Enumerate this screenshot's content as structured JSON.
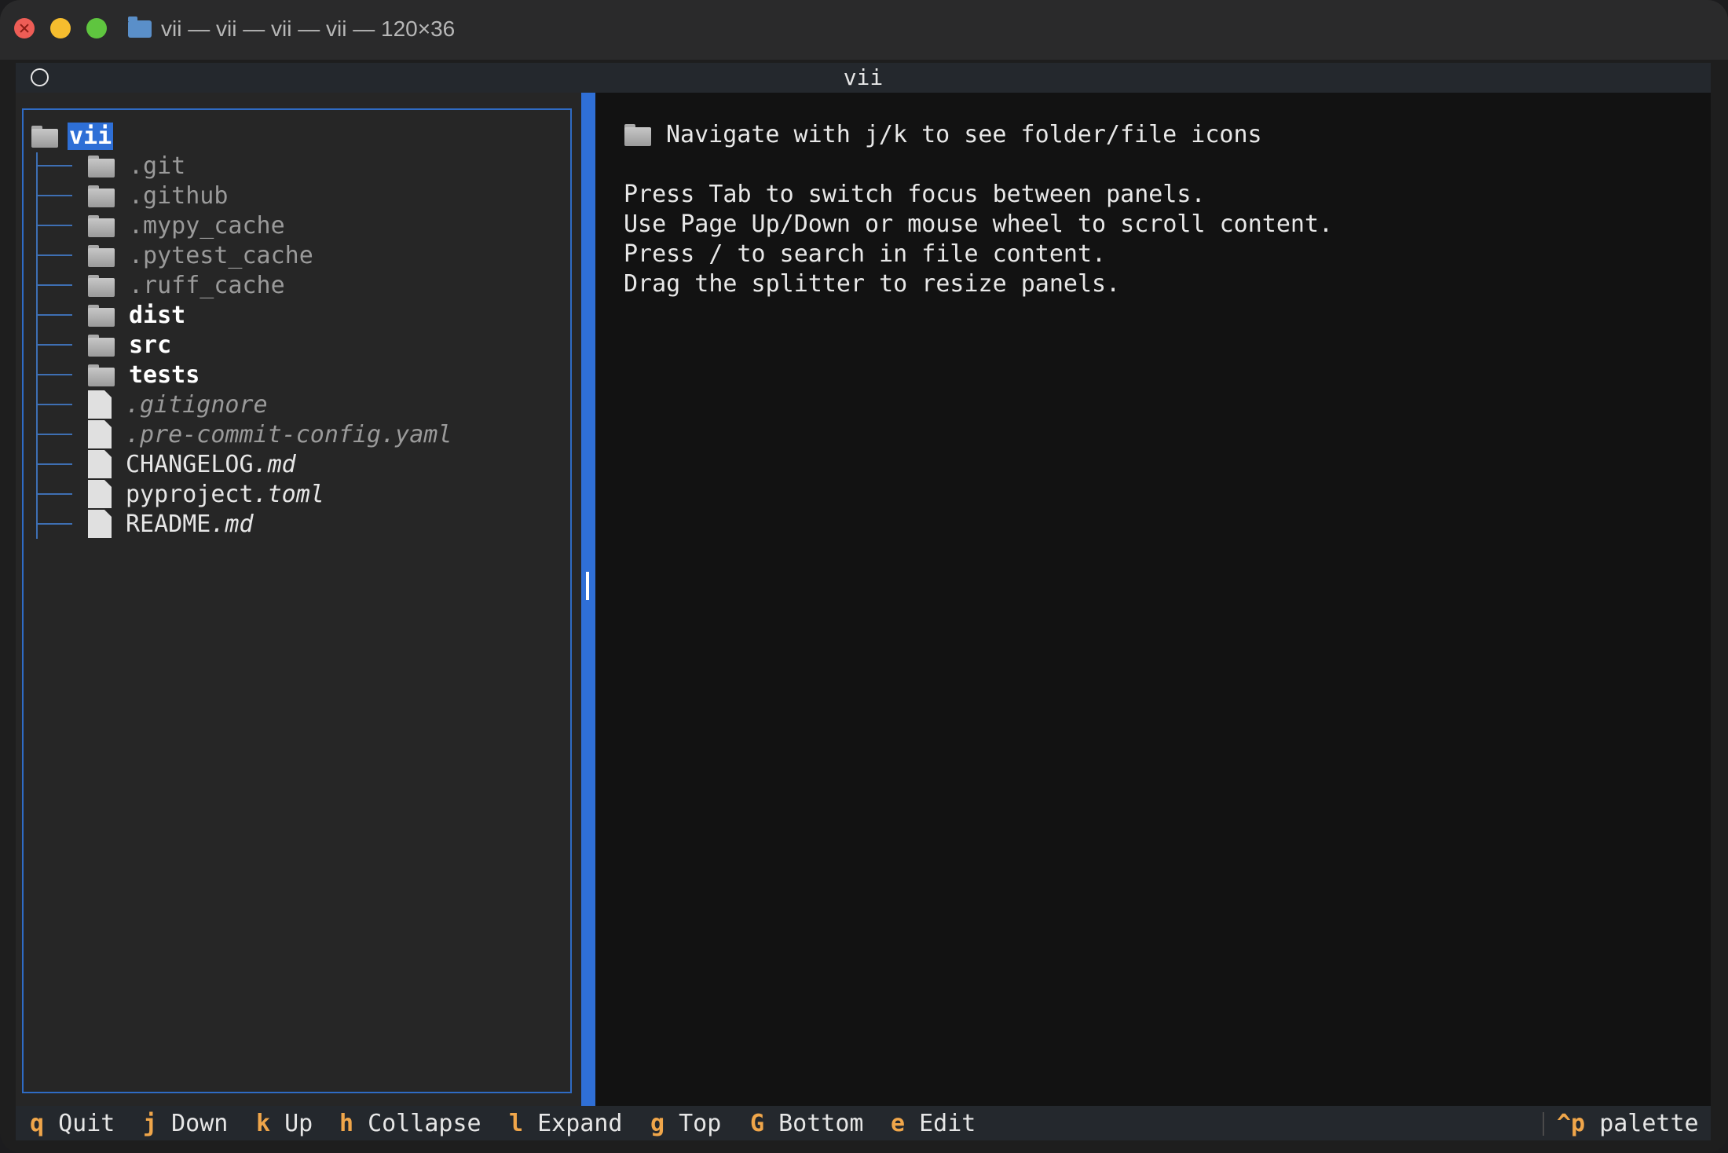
{
  "window": {
    "title": "vii — vii — vii — vii — 120×36"
  },
  "header": {
    "title": "vii"
  },
  "tree": {
    "root": "vii",
    "items": [
      {
        "name": ".git",
        "type": "folder",
        "style": "dim"
      },
      {
        "name": ".github",
        "type": "folder",
        "style": "dim"
      },
      {
        "name": ".mypy_cache",
        "type": "folder",
        "style": "dim"
      },
      {
        "name": ".pytest_cache",
        "type": "folder",
        "style": "dim"
      },
      {
        "name": ".ruff_cache",
        "type": "folder",
        "style": "dim"
      },
      {
        "name": "dist",
        "type": "folder",
        "style": "bold"
      },
      {
        "name": "src",
        "type": "folder",
        "style": "bold"
      },
      {
        "name": "tests",
        "type": "folder",
        "style": "bold"
      },
      {
        "name": ".gitignore",
        "type": "file",
        "style": "dim-italic"
      },
      {
        "name": ".pre-commit-config.yaml",
        "type": "file",
        "style": "dim-italic"
      },
      {
        "name": "CHANGELOG",
        "ext": ".md",
        "type": "file",
        "style": "normal"
      },
      {
        "name": "pyproject",
        "ext": ".toml",
        "type": "file",
        "style": "normal"
      },
      {
        "name": "README",
        "ext": ".md",
        "type": "file",
        "style": "normal"
      }
    ]
  },
  "preview": {
    "heading": "Navigate with j/k to see folder/file icons",
    "lines": [
      "Press Tab to switch focus between panels.",
      "Use Page Up/Down or mouse wheel to scroll content.",
      "Press / to search in file content.",
      "Drag the splitter to resize panels."
    ]
  },
  "footer": {
    "keys": [
      {
        "key": "q",
        "label": "Quit"
      },
      {
        "key": "j",
        "label": "Down"
      },
      {
        "key": "k",
        "label": "Up"
      },
      {
        "key": "h",
        "label": "Collapse"
      },
      {
        "key": "l",
        "label": "Expand"
      },
      {
        "key": "g",
        "label": "Top"
      },
      {
        "key": "G",
        "label": "Bottom"
      },
      {
        "key": "e",
        "label": "Edit"
      }
    ],
    "palette": {
      "key": "^p",
      "label": "palette"
    }
  },
  "colors": {
    "accent": "#2f6fd6",
    "key_color": "#f0a64a",
    "tree_connector": "#3e6fb3"
  }
}
